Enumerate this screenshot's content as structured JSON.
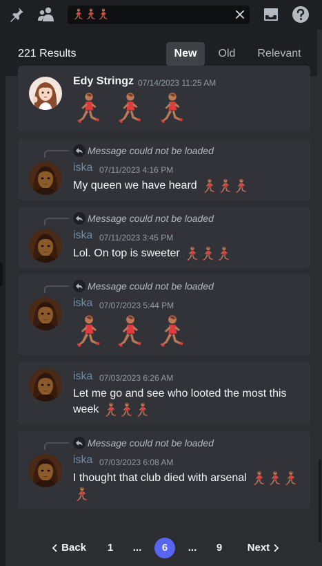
{
  "toolbar": {
    "search_query": "",
    "icons": [
      "pin-icon",
      "members-icon",
      "close-icon",
      "inbox-icon",
      "help-icon"
    ]
  },
  "results": {
    "count_label": "221 Results",
    "sort_options": [
      {
        "label": "New",
        "active": true
      },
      {
        "label": "Old",
        "active": false
      },
      {
        "label": "Relevant",
        "active": false
      }
    ]
  },
  "messages": [
    {
      "author": "Edy Stringz",
      "timestamp": "07/14/2023 11:25 AM",
      "reply": "",
      "text": "",
      "emoji_count": 3,
      "emoji": "woman-running-emoji"
    },
    {
      "author": "iska",
      "timestamp": "07/11/2023 4:16 PM",
      "reply": "Message could not be loaded",
      "text": "My queen we have heard",
      "emoji_count": 3,
      "emoji": "woman-running-emoji"
    },
    {
      "author": "iska",
      "timestamp": "07/11/2023 3:45 PM",
      "reply": "Message could not be loaded",
      "text": "Lol. On top is sweeter",
      "emoji_count": 3,
      "emoji": "woman-running-emoji"
    },
    {
      "author": "iska",
      "timestamp": "07/07/2023 5:44 PM",
      "reply": "Message could not be loaded",
      "text": "",
      "emoji_count": 3,
      "emoji": "woman-running-emoji"
    },
    {
      "author": "iska",
      "timestamp": "07/03/2023 6:26 AM",
      "reply": "",
      "text": "Let me go and see who looted the most this week",
      "emoji_count": 3,
      "emoji": "woman-running-emoji"
    },
    {
      "author": "iska",
      "timestamp": "07/03/2023 6:08 AM",
      "reply": "Message could not be loaded",
      "text": "I thought that club died with arsenal",
      "emoji_count": 4,
      "emoji": "woman-running-emoji"
    }
  ],
  "pagination": {
    "back_label": "Back",
    "next_label": "Next",
    "pages": [
      "1",
      "...",
      "6",
      "...",
      "9"
    ],
    "current": "6"
  },
  "colors": {
    "accent": "#5865f2",
    "iska_name": "#6e8caa",
    "runner_shirt": "#e03a3e",
    "runner_skin": "#b97a57"
  }
}
